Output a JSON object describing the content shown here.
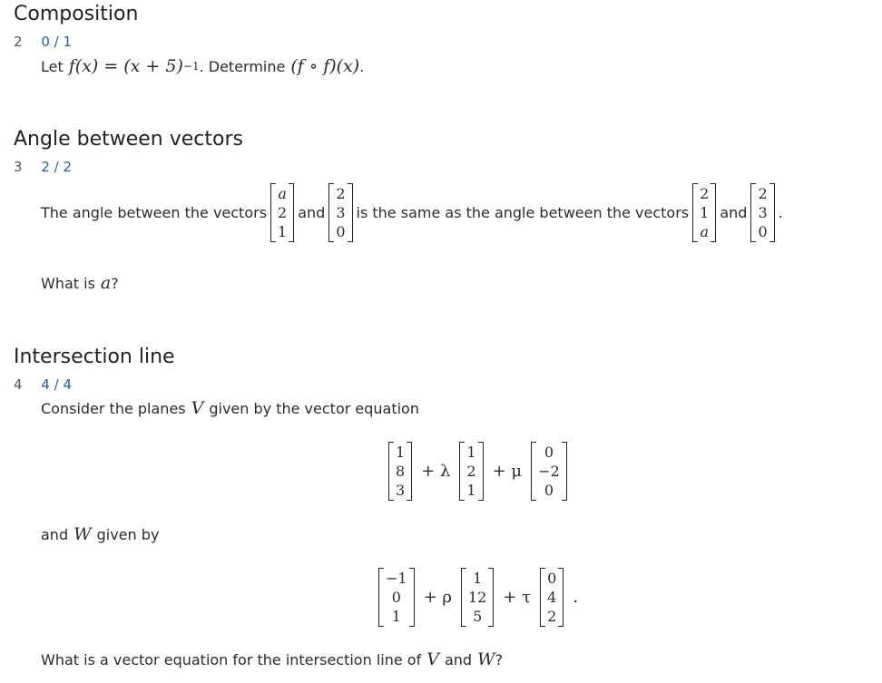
{
  "sections": [
    {
      "title": "Composition",
      "number": "2",
      "score": "0 / 1",
      "question": {
        "prefix": "Let",
        "f_def_lhs": "f(x)",
        "eq": "=",
        "f_def_rhs": "(x + 5)",
        "exponent": "−1",
        "mid": ". Determine",
        "target": "(f ∘ f)(x)",
        "end": "."
      }
    },
    {
      "title": "Angle between vectors",
      "number": "3",
      "score": "2 / 2",
      "question": {
        "part1": "The angle between the vectors",
        "v1": [
          "a",
          "2",
          "1"
        ],
        "and1": "and",
        "v2": [
          "2",
          "3",
          "0"
        ],
        "part2": "is the same as the angle between the vectors",
        "v3": [
          "2",
          "1",
          "a"
        ],
        "and2": "and",
        "v4": [
          "2",
          "3",
          "0"
        ],
        "end": "."
      },
      "followup": {
        "prefix": "What is",
        "var": "a",
        "suffix": "?"
      }
    },
    {
      "title": "Intersection line",
      "number": "4",
      "score": "4 / 4",
      "intro": {
        "prefix": "Consider the planes",
        "var": "V",
        "suffix": "given by the vector equation"
      },
      "plane_v": {
        "p": [
          "1",
          "8",
          "3"
        ],
        "op1": "+ λ",
        "d1": [
          "1",
          "2",
          "1"
        ],
        "op2": "+ μ",
        "d2": [
          "0",
          "−2",
          "0"
        ]
      },
      "and_w": {
        "prefix": "and",
        "var": "W",
        "suffix": "given by"
      },
      "plane_w": {
        "p": [
          "−1",
          "0",
          "1"
        ],
        "op1": "+ ρ",
        "d1": [
          "1",
          "12",
          "5"
        ],
        "op2": "+ τ",
        "d2": [
          "0",
          "4",
          "2"
        ],
        "end": "."
      },
      "final": {
        "prefix": "What is a vector equation for the intersection line of",
        "v1": "V",
        "and": "and",
        "v2": "W",
        "suffix": "?"
      }
    }
  ]
}
